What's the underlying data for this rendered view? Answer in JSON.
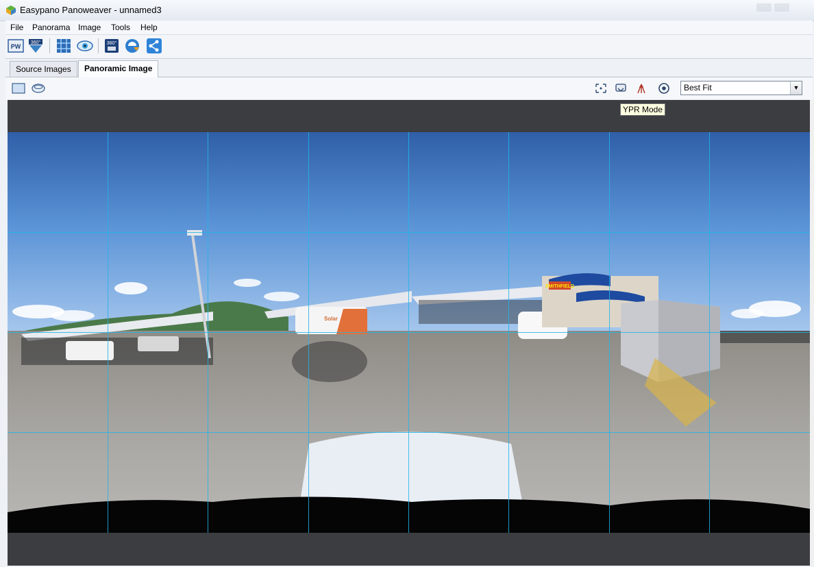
{
  "window": {
    "title": "Easypano Panoweaver - unnamed3"
  },
  "menu": {
    "items": [
      "File",
      "Panorama",
      "Image",
      "Tools",
      "Help"
    ]
  },
  "toolbar": {
    "buttons": [
      {
        "icon": "pw-icon",
        "label": "PW"
      },
      {
        "icon": "360-publish-icon",
        "label": "360°"
      },
      {
        "icon": "stitch-icon"
      },
      {
        "icon": "preview-eye-icon"
      },
      {
        "icon": "save-360-icon",
        "label": "360°"
      },
      {
        "icon": "publish-web-icon"
      },
      {
        "icon": "share-icon"
      }
    ]
  },
  "tabs": [
    {
      "label": "Source Images",
      "active": false
    },
    {
      "label": "Panoramic Image",
      "active": true
    }
  ],
  "viewbar": {
    "left_icons": [
      "flat-view-icon",
      "spherical-view-icon"
    ],
    "right_icons": [
      "fit-icon",
      "ypr-mode-icon",
      "tripod-icon",
      "target-icon"
    ],
    "zoom_select": {
      "value": "Best Fit"
    },
    "tooltip": "YPR Mode"
  },
  "canvas": {
    "background_color": "#3b3d40",
    "grid_color": "#22b4e6",
    "grid_columns": 8,
    "grid_rows": 4
  },
  "panorama_signage": {
    "building_sign": "SMITHFIELD",
    "van_text": "Solar"
  }
}
